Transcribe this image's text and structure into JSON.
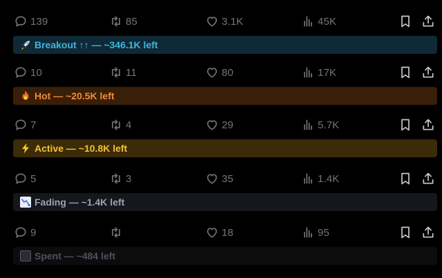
{
  "posts": [
    {
      "reply_count": "139",
      "repost_count": "85",
      "like_count": "3.1K",
      "view_count": "45K",
      "badge": {
        "emoji": "rocket-icon",
        "label": "Breakout ↑↑ — ~346.1K left",
        "color": "#3fb6dd",
        "bg": "#0f2a36"
      }
    },
    {
      "reply_count": "10",
      "repost_count": "11",
      "like_count": "80",
      "view_count": "17K",
      "badge": {
        "emoji": "fire-icon",
        "label": "Hot — ~20.5K left",
        "color": "#f08a3c",
        "bg": "#3a1f08"
      }
    },
    {
      "reply_count": "7",
      "repost_count": "4",
      "like_count": "29",
      "view_count": "5.7K",
      "badge": {
        "emoji": "lightning-icon",
        "label": "Active — ~10.8K left",
        "color": "#f2c233",
        "bg": "#3b2b07"
      }
    },
    {
      "reply_count": "5",
      "repost_count": "3",
      "like_count": "35",
      "view_count": "1.4K",
      "badge": {
        "emoji": "chart-decreasing-icon",
        "label": "Fading — ~1.4K left",
        "color": "#9aa3b2",
        "bg": "#15171c"
      }
    },
    {
      "reply_count": "9",
      "repost_count": "",
      "like_count": "18",
      "view_count": "95",
      "badge": {
        "emoji": "black-square-icon",
        "label": "Spent — ~484 left",
        "color": "#4d525a",
        "bg": "#0c0c0e"
      }
    }
  ],
  "colors": {
    "background": "#000000",
    "action_gray": "#71767b"
  }
}
